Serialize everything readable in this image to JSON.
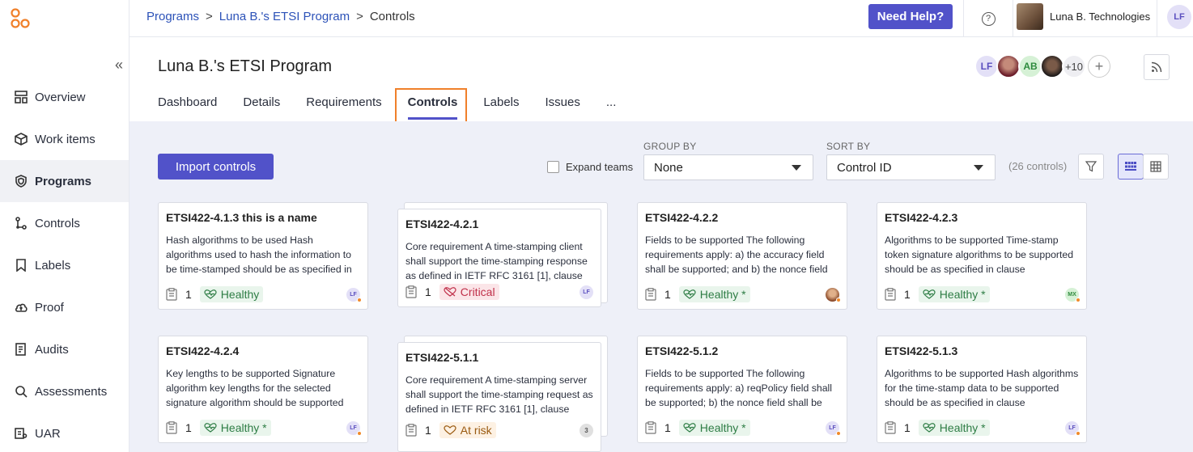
{
  "sidebar": {
    "collapse_glyph": "«",
    "items": [
      {
        "label": "Overview",
        "icon": "overview-icon",
        "active": false
      },
      {
        "label": "Work items",
        "icon": "box-icon",
        "active": false
      },
      {
        "label": "Programs",
        "icon": "shield-icon",
        "active": true
      },
      {
        "label": "Controls",
        "icon": "controls-icon",
        "active": false
      },
      {
        "label": "Labels",
        "icon": "label-icon",
        "active": false
      },
      {
        "label": "Proof",
        "icon": "cloud-icon",
        "active": false
      },
      {
        "label": "Audits",
        "icon": "audit-icon",
        "active": false
      },
      {
        "label": "Assessments",
        "icon": "search-icon",
        "active": false
      },
      {
        "label": "UAR",
        "icon": "uar-icon",
        "active": false
      }
    ]
  },
  "topbar": {
    "breadcrumb": {
      "root": "Programs",
      "program": "Luna B.'s ETSI Program",
      "current": "Controls",
      "sep": ">"
    },
    "help_label": "Need Help?",
    "help_icon": "?",
    "org_name": "Luna B. Technologies",
    "user_initials": "LF"
  },
  "program": {
    "title": "Luna B.'s ETSI Program",
    "members": {
      "m1": "LF",
      "m3": "AB",
      "more": "+10",
      "add": "+"
    },
    "tabs": [
      "Dashboard",
      "Details",
      "Requirements",
      "Controls",
      "Labels",
      "Issues",
      "..."
    ],
    "active_tab": "Controls"
  },
  "toolbar": {
    "import_label": "Import controls",
    "expand_label": "Expand teams",
    "group_by_label": "GROUP BY",
    "group_by_value": "None",
    "sort_by_label": "SORT BY",
    "sort_by_value": "Control ID",
    "count_text": "(26 controls)"
  },
  "cards": [
    {
      "title": "ETSI422-4.1.3 this is a name",
      "desc": "Hash algorithms to be used Hash algorithms used to hash the information to be time-stamped should be as specified in clause",
      "count": "1",
      "status": "Healthy",
      "owner": "LF"
    },
    {
      "title": "ETSI422-4.2.1",
      "desc": "Core requirement A time-stamping client shall support the time-stamping response as defined in IETF RFC 3161 [1], clause",
      "count": "1",
      "status": "Critical",
      "owner": "LF"
    },
    {
      "title": "ETSI422-4.2.2",
      "desc": "Fields to be supported The following requirements apply: a) the accuracy field shall be supported; and b) the nonce field shall be",
      "count": "1",
      "status": "Healthy *",
      "owner": ""
    },
    {
      "title": "ETSI422-4.2.3",
      "desc": "Algorithms to be supported Time-stamp token signature algorithms to be supported should be as specified in clause",
      "count": "1",
      "status": "Healthy *",
      "owner": "MX"
    },
    {
      "title": "ETSI422-4.2.4",
      "desc": "Key lengths to be supported Signature algorithm key lengths for the selected signature algorithm should be supported",
      "count": "1",
      "status": "Healthy *",
      "owner": "LF"
    },
    {
      "title": "ETSI422-5.1.1",
      "desc": "Core requirement A time-stamping server shall support the time-stamping request as defined in IETF RFC 3161 [1], clause",
      "count": "1",
      "status": "At risk",
      "owner": "3"
    },
    {
      "title": "ETSI422-5.1.2",
      "desc": "Fields to be supported The following requirements apply: a) reqPolicy field shall be supported; b) the nonce field shall be",
      "count": "1",
      "status": "Healthy *",
      "owner": "LF"
    },
    {
      "title": "ETSI422-5.1.3",
      "desc": "Algorithms to be supported Hash algorithms for the time-stamp data to be supported should be as specified in clause",
      "count": "1",
      "status": "Healthy *",
      "owner": "LF"
    }
  ],
  "colors": {
    "accent": "#5152c9",
    "healthy": "#2e7d45",
    "critical": "#c0304a",
    "at_risk": "#9a5a10",
    "highlight": "#f0802a"
  }
}
